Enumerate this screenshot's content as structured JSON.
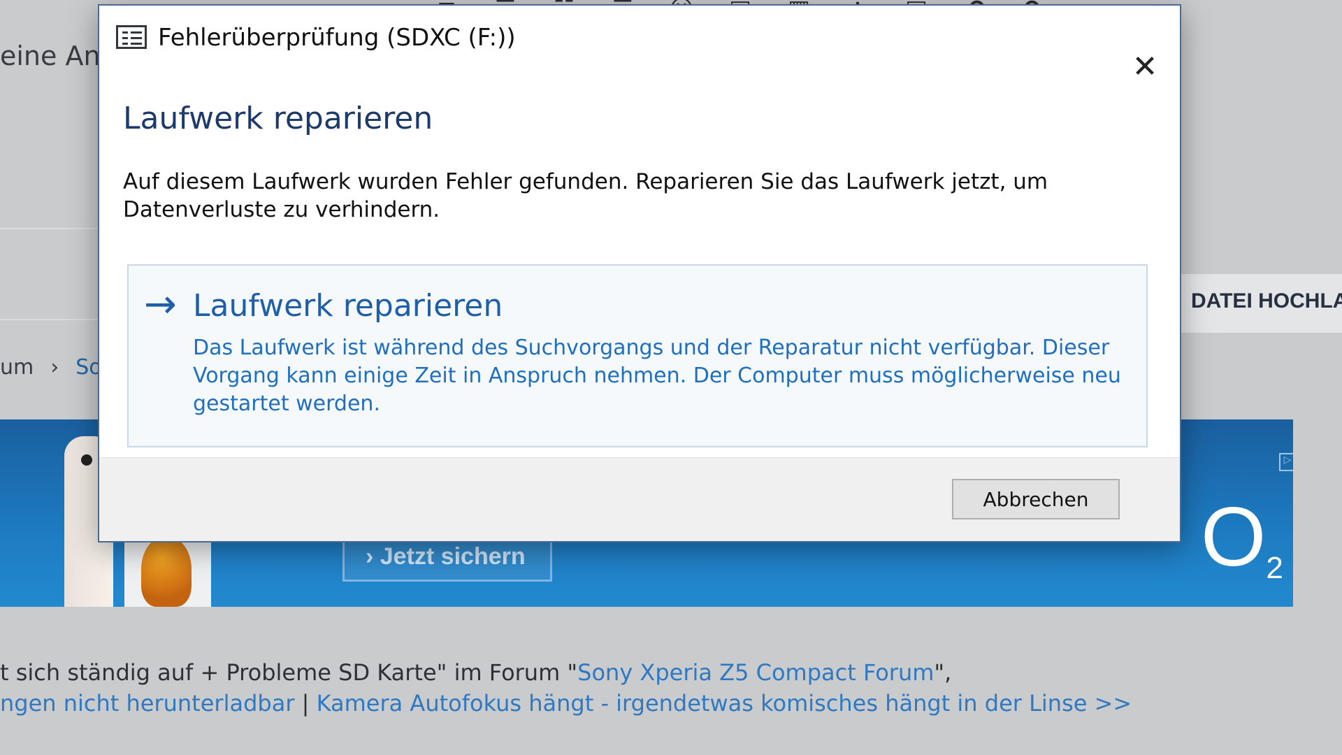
{
  "background_page": {
    "left_text": "eine Antw",
    "breadcrumb": [
      "um",
      "›",
      "So"
    ],
    "upload_button_label": "DATEI HOCHLAD",
    "toolbar_icons": [
      "list-icon",
      "align-left-icon",
      "align-center-icon",
      "align-right-icon",
      "smiley-icon",
      "image-icon",
      "film-icon",
      "plus-icon",
      "save-icon",
      "undo-icon",
      "redo-icon"
    ],
    "toolbar_glyphs": [
      "≡",
      "☰",
      "☷",
      "☰",
      "☺",
      "▣",
      "▦",
      "+",
      "▤",
      "↶",
      "↷"
    ],
    "ad": {
      "cta_label": "› Jetzt sichern",
      "logo_text": "O",
      "logo_sub": "2",
      "info_glyph": "▷"
    },
    "footer": {
      "line1_prefix": "t sich ständig auf + Probleme SD Karte\" im Forum \"",
      "line1_link": "Sony Xperia Z5 Compact Forum",
      "line1_suffix": "\",",
      "line2_link1": "ngen nicht herunterladbar",
      "line2_sep": " | ",
      "line2_link2": "Kamera Autofokus hängt - irgendetwas komisches hängt in der Linse",
      "line2_more": " >>"
    }
  },
  "dialog": {
    "title": "Fehlerüberprüfung (SDXC (F:))",
    "close_glyph": "✕",
    "heading": "Laufwerk reparieren",
    "message": "Auf diesem Laufwerk wurden Fehler gefunden. Reparieren Sie das Laufwerk jetzt, um Datenverluste zu verhindern.",
    "option": {
      "arrow_glyph": "→",
      "title": "Laufwerk reparieren",
      "description": "Das Laufwerk ist während des Suchvorgangs und der Reparatur nicht verfügbar. Dieser Vorgang kann einige Zeit in Anspruch nehmen. Der Computer muss möglicherweise neu gestartet werden."
    },
    "cancel_label": "Abbrechen"
  }
}
